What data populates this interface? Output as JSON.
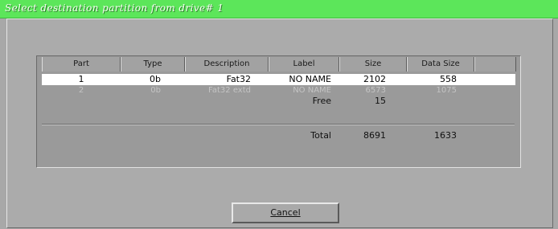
{
  "window": {
    "title": "Select destination partition from drive# 1"
  },
  "table": {
    "columns": [
      "Part",
      "Type",
      "Description",
      "Label",
      "Size",
      "Data Size"
    ],
    "rows": [
      {
        "part": "1",
        "type": "0b",
        "description": "Fat32",
        "label": "NO NAME",
        "size": "2102",
        "data_size": "558",
        "state": "selected"
      },
      {
        "part": "2",
        "type": "0b",
        "description": "Fat32 extd",
        "label": "NO NAME",
        "size": "6573",
        "data_size": "1075",
        "state": "disabled"
      }
    ],
    "free": {
      "label": "Free",
      "size": "15"
    },
    "total": {
      "label": "Total",
      "size": "8691",
      "data_size": "1633"
    }
  },
  "buttons": {
    "cancel": "Cancel"
  }
}
